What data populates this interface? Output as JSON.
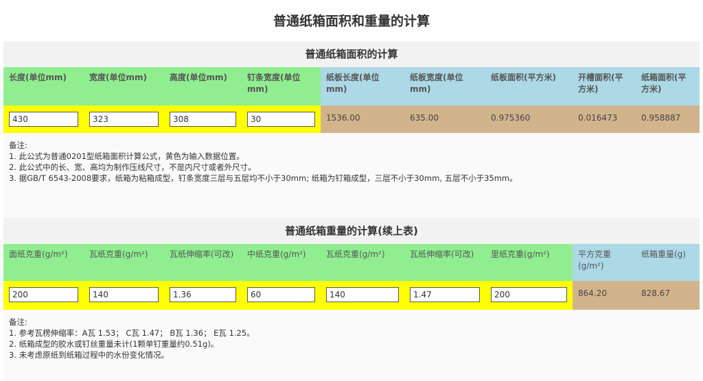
{
  "page_title": "普通纸箱面积和重量的计算",
  "area": {
    "title": "普通纸箱面积的计算",
    "headers": [
      {
        "label": "长度(单位mm)",
        "kind": "input"
      },
      {
        "label": "宽度(单位mm)",
        "kind": "input"
      },
      {
        "label": "高度(单位mm)",
        "kind": "input"
      },
      {
        "label": "钉条宽度(单位mm)",
        "kind": "input"
      },
      {
        "label": "纸板长度(单位mm)",
        "kind": "output"
      },
      {
        "label": "纸板宽度(单位mm)",
        "kind": "output"
      },
      {
        "label": "纸板面积(平方米)",
        "kind": "output"
      },
      {
        "label": "开槽面积(平方米)",
        "kind": "output"
      },
      {
        "label": "纸箱面积(平方米)",
        "kind": "output"
      }
    ],
    "inputs": [
      "430",
      "323",
      "308",
      "30"
    ],
    "outputs": [
      "1536.00",
      "635.00",
      "0.975360",
      "0.016473",
      "0.958887"
    ],
    "notes_title": "备注:",
    "notes": [
      "1. 此公式为普通0201型纸箱面积计算公式，黄色为输入数据位置。",
      "2. 此公式中的长、宽、高均为制作压线尺寸，不是内尺寸或者外尺寸。",
      "3. 据GB/T 6543-2008要求，纸箱为粘箱成型，钉条宽度三层与五层均不小于30mm; 纸箱为钉箱成型，三层不小于30mm, 五层不小于35mm。"
    ]
  },
  "weight": {
    "title": "普通纸箱重量的计算(续上表)",
    "headers": [
      {
        "label": "面纸克重(g/m²)",
        "kind": "input"
      },
      {
        "label": "瓦纸克重(g/m²)",
        "kind": "input"
      },
      {
        "label": "瓦纸伸缩率(可改)",
        "kind": "input"
      },
      {
        "label": "中纸克重(g/m²)",
        "kind": "input"
      },
      {
        "label": "瓦纸克重(g/m²)",
        "kind": "input"
      },
      {
        "label": "瓦纸伸缩率(可改)",
        "kind": "input"
      },
      {
        "label": "里纸克重(g/m²)",
        "kind": "input"
      },
      {
        "label": "平方克重(g/m²)",
        "kind": "output"
      },
      {
        "label": "纸箱重量(g)",
        "kind": "output"
      }
    ],
    "inputs": [
      "200",
      "140",
      "1.36",
      "60",
      "140",
      "1.47",
      "200"
    ],
    "outputs": [
      "864.20",
      "828.67"
    ],
    "notes_title": "备注:",
    "notes": [
      "1. 参考瓦楞伸缩率：A瓦 1.53； C瓦 1.47； B瓦 1.36； E瓦 1.25。",
      "2. 纸箱成型的胶水或钉丝重量未计(1颗单钉重量约0.51g)。",
      "3. 未考虑原纸到纸箱过程中的水份变化情况。"
    ]
  },
  "colors": {
    "input_header": "#90ee90",
    "output_header": "#add8e6",
    "input_cell": "#ffff00",
    "output_cell": "#d2b48c"
  }
}
